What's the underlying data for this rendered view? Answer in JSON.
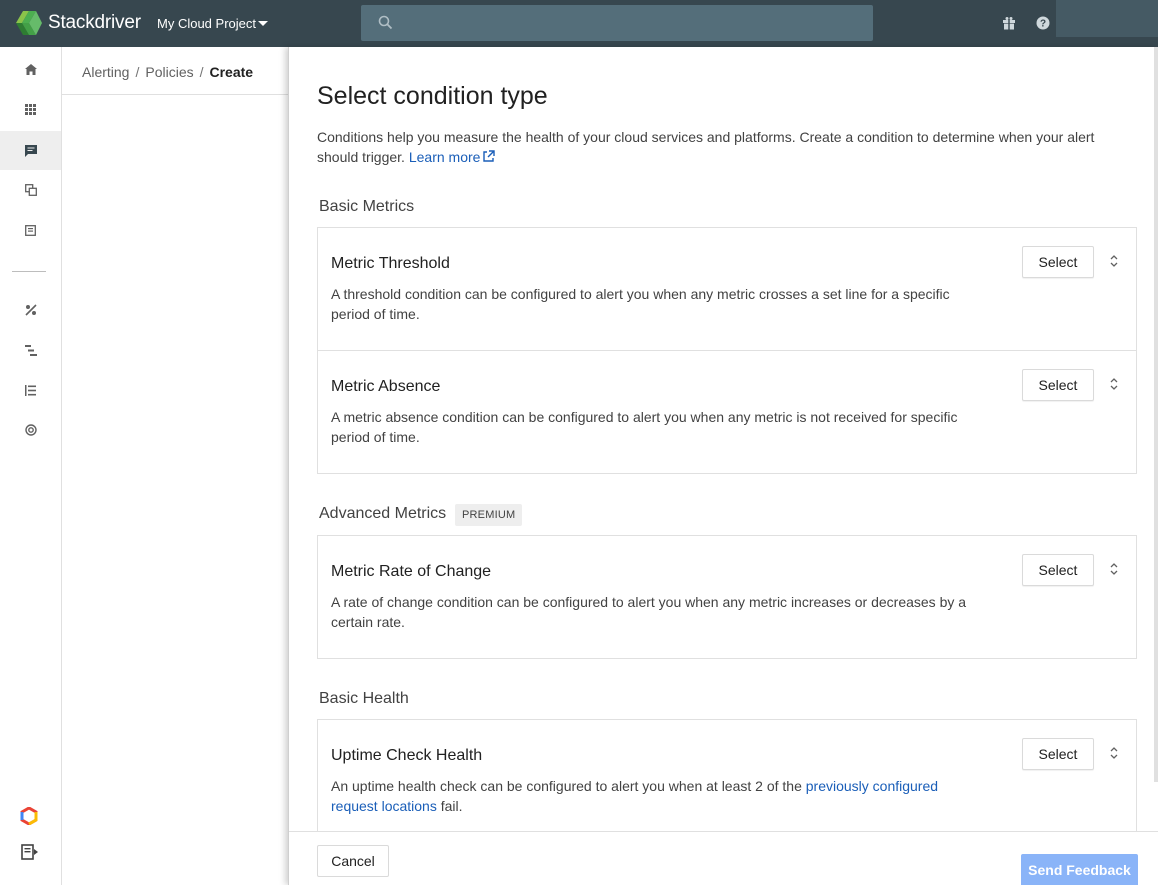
{
  "topbar": {
    "brand": "Stackdriver",
    "project": "My Cloud Project",
    "search_placeholder": ""
  },
  "sidebar": {
    "items": [
      {
        "icon": "home-icon"
      },
      {
        "icon": "dashboards-icon"
      },
      {
        "icon": "alerting-icon",
        "active": true
      },
      {
        "icon": "uptime-checks-icon"
      },
      {
        "icon": "groups-icon"
      },
      {
        "icon": "debug-icon"
      },
      {
        "icon": "trace-icon"
      },
      {
        "icon": "logging-icon"
      },
      {
        "icon": "profiler-icon"
      }
    ],
    "bottom": [
      {
        "icon": "google-cloud-icon"
      },
      {
        "icon": "docs-icon"
      }
    ]
  },
  "breadcrumb": {
    "items": [
      "Alerting",
      "Policies"
    ],
    "current": "Create"
  },
  "dialog": {
    "title": "Select condition type",
    "description": "Conditions help you measure the health of your cloud services and platforms. Create a condition to determine when your alert should trigger.",
    "learn_more": "Learn more",
    "sections": [
      {
        "title": "Basic Metrics",
        "cards": [
          {
            "title": "Metric Threshold",
            "description": "A threshold condition can be configured to alert you when any metric crosses a set line for a specific period of time.",
            "button": "Select"
          },
          {
            "title": "Metric Absence",
            "description": "A metric absence condition can be configured to alert you when any metric is not received for specific period of time.",
            "button": "Select"
          }
        ]
      },
      {
        "title": "Advanced Metrics",
        "badge": "PREMIUM",
        "cards": [
          {
            "title": "Metric Rate of Change",
            "description": "A rate of change condition can be configured to alert you when any metric increases or decreases by a certain rate.",
            "button": "Select"
          }
        ]
      },
      {
        "title": "Basic Health",
        "cards": [
          {
            "title": "Uptime Check Health",
            "description_prefix": "An uptime health check can be configured to alert you when at least 2 of the ",
            "description_link": "previously configured request locations",
            "description_suffix": " fail.",
            "button": "Select"
          }
        ]
      }
    ]
  },
  "footer": {
    "cancel": "Cancel",
    "feedback": "Send Feedback"
  },
  "colors": {
    "topbar": "#37474f",
    "link": "#1a5eb8",
    "feedback": "#8ab4f8"
  }
}
